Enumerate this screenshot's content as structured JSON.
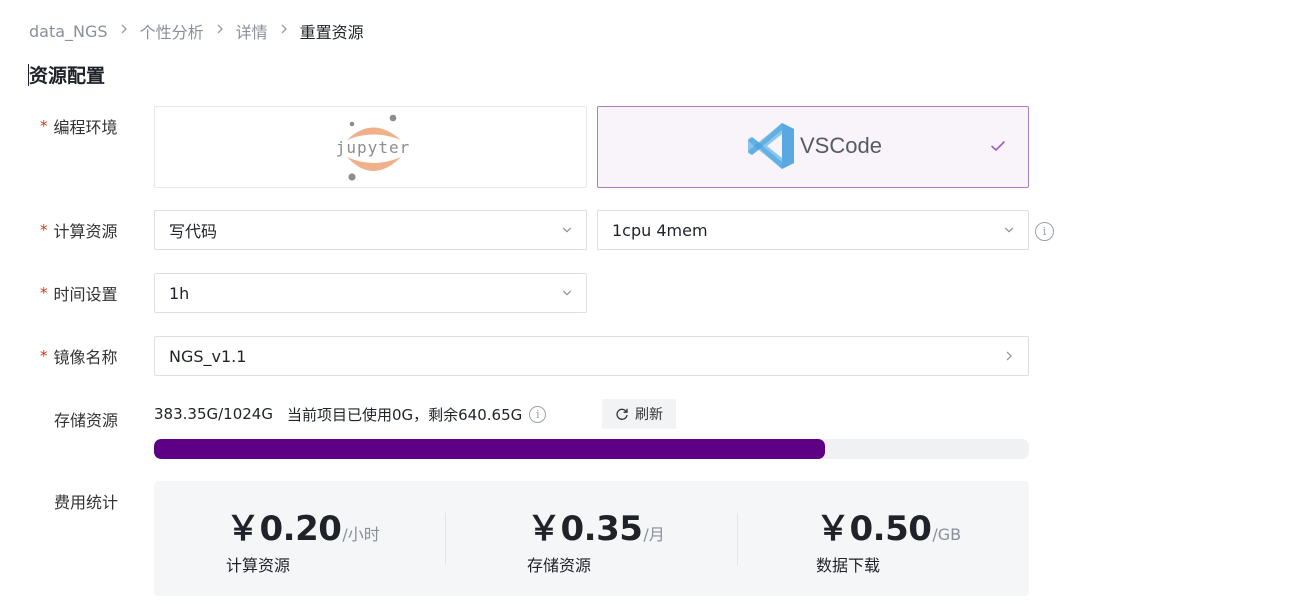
{
  "breadcrumb": {
    "items": [
      "data_NGS",
      "个性分析",
      "详情",
      "重置资源"
    ],
    "separator": ">"
  },
  "section_title": "资源配置",
  "form": {
    "env": {
      "label": "编程环境",
      "options": [
        {
          "name": "jupyter",
          "selected": false
        },
        {
          "name": "VSCode",
          "selected": true
        }
      ]
    },
    "compute": {
      "label": "计算资源",
      "type_value": "写代码",
      "spec_value": "1cpu 4mem"
    },
    "time": {
      "label": "时间设置",
      "value": "1h"
    },
    "image": {
      "label": "镜像名称",
      "value": "NGS_v1.1"
    },
    "storage": {
      "label": "存储资源",
      "usage": "383.35G/1024G",
      "detail": "当前项目已使用0G，剩余640.65G",
      "refresh_label": "刷新",
      "used_fraction": 0.767
    },
    "fees": {
      "label": "费用统计",
      "items": [
        {
          "amount": "￥0.20",
          "unit": "/小时",
          "name": "计算资源"
        },
        {
          "amount": "￥0.35",
          "unit": "/月",
          "name": "存储资源"
        },
        {
          "amount": "￥0.50",
          "unit": "/GB",
          "name": "数据下载"
        }
      ]
    }
  },
  "colors": {
    "accent": "#5e0085",
    "selected_border": "#b07abf",
    "required_star": "#d4380d",
    "jupyter_orange": "#f37626",
    "vscode_blue": "#3e9ed8"
  },
  "icons": [
    "chevron-right-icon",
    "chevron-down-icon",
    "check-icon",
    "info-icon",
    "refresh-icon",
    "jupyter-logo",
    "vscode-logo"
  ]
}
